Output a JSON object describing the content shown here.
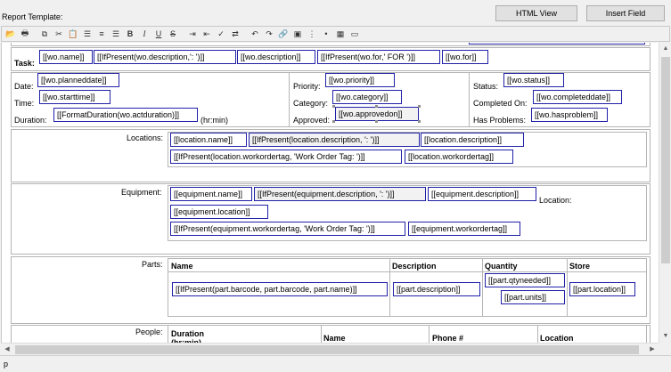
{
  "header": {
    "title": "Report Template:",
    "html_view_button": "HTML View",
    "insert_field_button": "Insert Field"
  },
  "toolbar": {
    "buttons": [
      "open-icon",
      "print-icon",
      "copy-icon",
      "cut-icon",
      "paste-icon",
      "align-left-icon",
      "align-center-icon",
      "align-right-icon",
      "bold-icon",
      "italic-icon",
      "underline-icon",
      "strikethrough-icon",
      "indent-icon",
      "outdent-icon",
      "spellcheck-icon",
      "find-replace-icon",
      "undo-icon",
      "redo-icon",
      "link-icon",
      "image-icon",
      "ordered-list-icon",
      "unordered-list-icon",
      "table-icon",
      "horizontal-rule-icon"
    ],
    "bold": "B",
    "italic": "I",
    "underline": "U",
    "strike": "S"
  },
  "task": {
    "label": "Task:",
    "fields": [
      "[[wo.name]]",
      "[[IfPresent(wo.description,': ')]]",
      "[[wo.description]]",
      "[[IfPresent(wo.for,' FOR ')]]",
      "[[wo.for]]"
    ]
  },
  "details": {
    "date_label": "Date:",
    "date": "[[wo.planneddate]]",
    "time_label": "Time:",
    "time": "[[wo.starttime]]",
    "duration_label": "Duration:",
    "duration": "[[FormatDuration(wo.actduration)]]",
    "duration_unit": "(hr:min)",
    "priority_label": "Priority:",
    "priority": "[[wo.priority]]",
    "category_label": "Category:",
    "category": "[[wo.category]]",
    "approved_label": "Approved:",
    "approved": "[[wo.approvedon]]",
    "status_label": "Status:",
    "status": "[[wo.status]]",
    "completed_label": "Completed On:",
    "completed": "[[wo.completeddate]]",
    "problems_label": "Has Problems:",
    "problems": "[[wo.hasproblem]]"
  },
  "locations": {
    "label": "Locations:",
    "fields": [
      "[[location.name]]",
      "[[IfPresent(location.description, ': ')]]",
      "[[location.description]]",
      "[[IfPresent(location.workordertag, 'Work Order Tag: ')]]",
      "[[location.workordertag]]"
    ]
  },
  "equipment": {
    "label": "Equipment:",
    "fields": [
      "[[equipment.name]]",
      "[[IfPresent(equipment.description, ': ')]]",
      "[[equipment.description]]",
      "[[equipment.location]]",
      "[[IfPresent(equipment.workordertag, 'Work Order Tag: ')]]",
      "[[equipment.workordertag]]"
    ],
    "location_label": "Location:"
  },
  "parts": {
    "label": "Parts:",
    "columns": [
      "Name",
      "Description",
      "Quantity",
      "Store"
    ],
    "fields": [
      "[[IfPresent(part.barcode, part.barcode, part.name)]]",
      "[[part.description]]",
      "[[part.qtyneeded]]",
      "[[part.units]]",
      "[[part.location]]"
    ]
  },
  "people": {
    "label": "People:",
    "columns": [
      "Duration (hr:min)",
      "Name",
      "Phone #",
      "Location"
    ]
  },
  "statusbar": {
    "text": "p"
  }
}
